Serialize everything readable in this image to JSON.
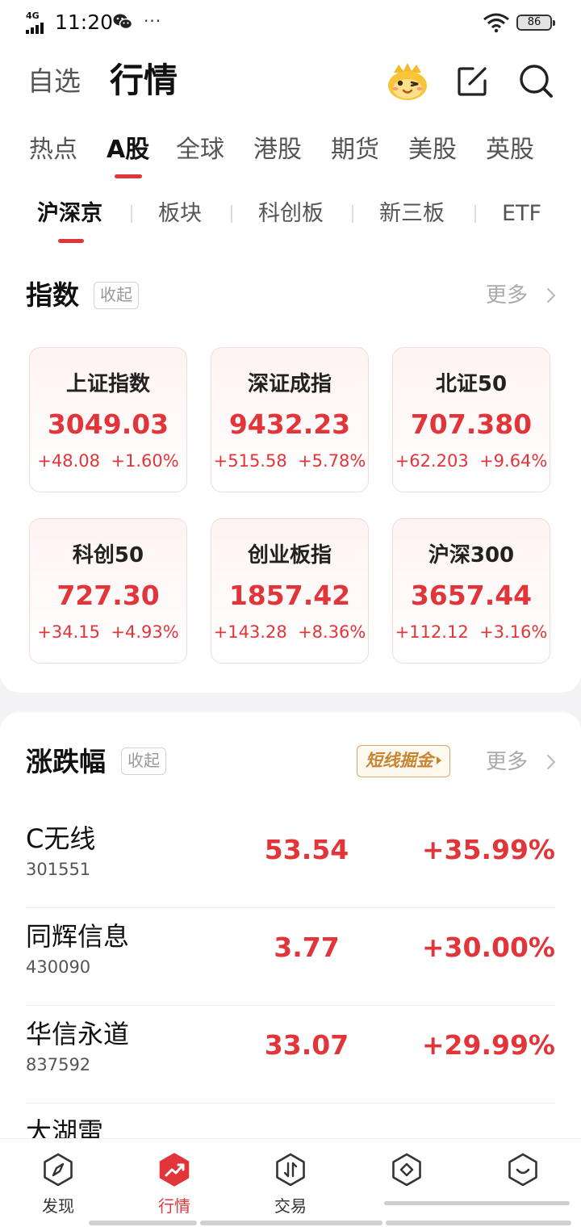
{
  "status_bar": {
    "network": "4G",
    "time": "11:20",
    "more": "···",
    "battery": "86"
  },
  "header": {
    "watchlist_label": "自选",
    "market_label": "行情",
    "icons": [
      "mascot-icon",
      "edit-icon",
      "search-icon"
    ]
  },
  "market_tabs": [
    "热点",
    "A股",
    "全球",
    "港股",
    "期货",
    "美股",
    "英股"
  ],
  "market_tab_active": "A股",
  "sub_tabs": [
    "沪深京",
    "板块",
    "科创板",
    "新三板",
    "ETF"
  ],
  "sub_tab_active": "沪深京",
  "index_section": {
    "title": "指数",
    "collapse_label": "收起",
    "more_label": "更多",
    "cards": [
      {
        "name": "上证指数",
        "value": "3049.03",
        "change": "+48.08",
        "pct": "+1.60%"
      },
      {
        "name": "深证成指",
        "value": "9432.23",
        "change": "+515.58",
        "pct": "+5.78%"
      },
      {
        "name": "北证50",
        "value": "707.380",
        "change": "+62.203",
        "pct": "+9.64%"
      },
      {
        "name": "科创50",
        "value": "727.30",
        "change": "+34.15",
        "pct": "+4.93%"
      },
      {
        "name": "创业板指",
        "value": "1857.42",
        "change": "+143.28",
        "pct": "+8.36%"
      },
      {
        "name": "沪深300",
        "value": "3657.44",
        "change": "+112.12",
        "pct": "+3.16%"
      }
    ]
  },
  "movers_section": {
    "title": "涨跌幅",
    "collapse_label": "收起",
    "short_term_label": "短线掘金",
    "more_label": "更多",
    "rows": [
      {
        "name": "C无线",
        "code": "301551",
        "price": "53.54",
        "pct": "+35.99%"
      },
      {
        "name": "同辉信息",
        "code": "430090",
        "price": "3.77",
        "pct": "+30.00%"
      },
      {
        "name": "华信永道",
        "code": "837592",
        "price": "33.07",
        "pct": "+29.99%"
      },
      {
        "name": "大湖雷",
        "code": "",
        "price": "",
        "pct": ""
      }
    ]
  },
  "bottom_nav": [
    {
      "label": "发现",
      "icon": "compass-icon"
    },
    {
      "label": "行情",
      "icon": "trend-icon"
    },
    {
      "label": "交易",
      "icon": "trade-icon"
    },
    {
      "label": "",
      "icon": "diamond-icon"
    },
    {
      "label": "",
      "icon": "smile-icon"
    }
  ],
  "bottom_nav_active": "行情",
  "colors": {
    "accent_red": "#e2353a",
    "gold": "#c8852f",
    "muted": "#999999"
  }
}
